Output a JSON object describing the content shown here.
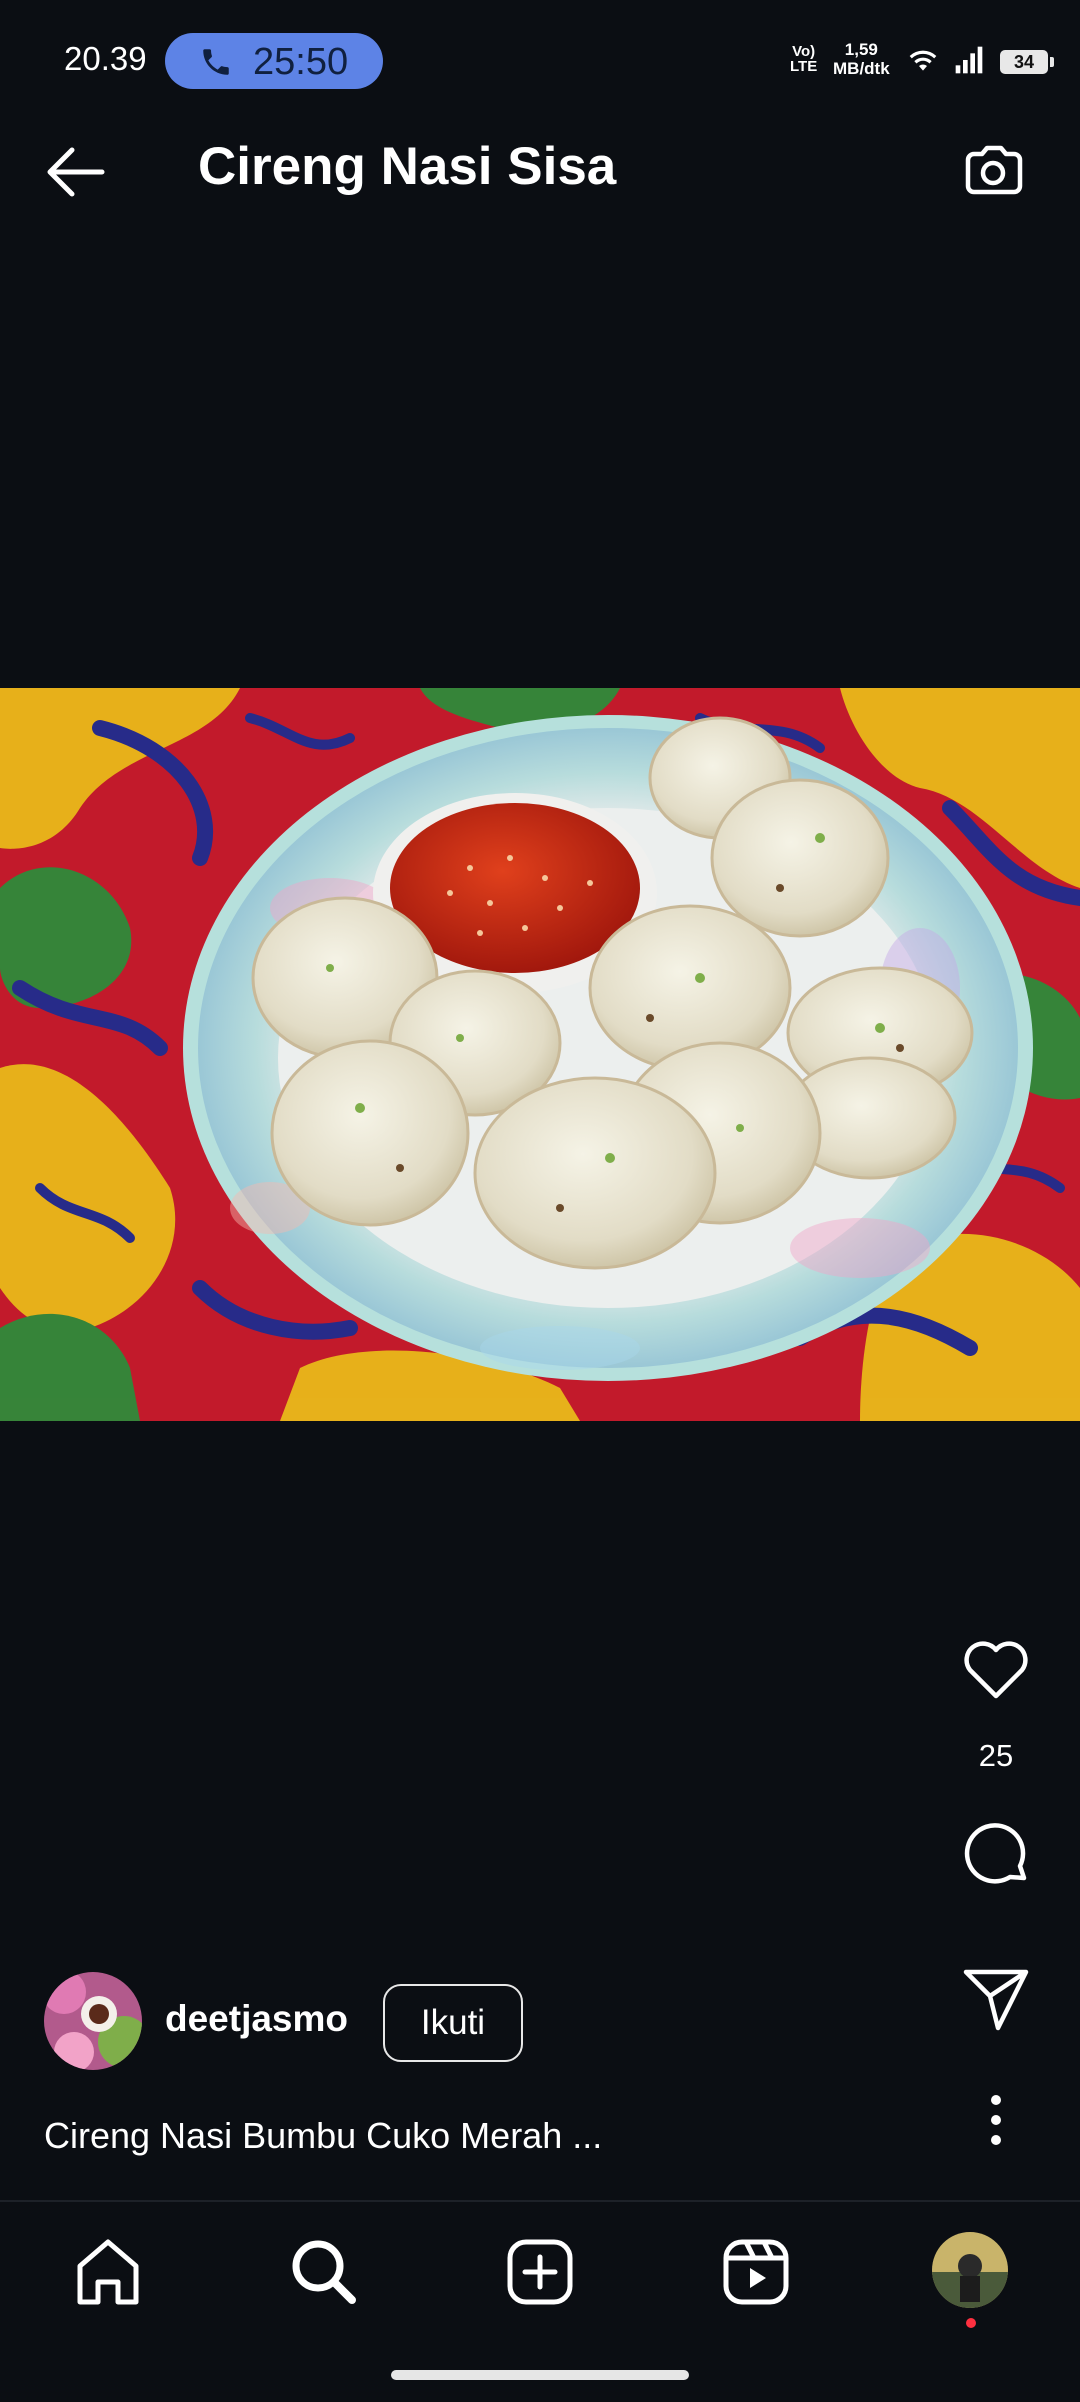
{
  "status_bar": {
    "time": "20.39",
    "call_timer": "25:50",
    "volte_line1": "Vo)",
    "volte_line2": "LTE",
    "net_speed_value": "1,59",
    "net_speed_unit": "MB/dtk",
    "battery": "34"
  },
  "header": {
    "title": "Cireng Nasi Sisa"
  },
  "post": {
    "like_count": "25",
    "username": "deetjasmo",
    "follow_label": "Ikuti",
    "caption": "Cireng Nasi Bumbu Cuko Merah ..."
  },
  "icons": {
    "back": "arrow-left-icon",
    "camera": "camera-icon",
    "like": "heart-icon",
    "comment": "comment-icon",
    "share": "send-icon",
    "more": "more-vertical-icon",
    "home": "home-icon",
    "search": "search-icon",
    "create": "plus-square-icon",
    "reels": "reels-icon"
  },
  "colors": {
    "background": "#0b0e13",
    "call_pill": "#5d83e6",
    "notification_dot": "#ff3040"
  }
}
